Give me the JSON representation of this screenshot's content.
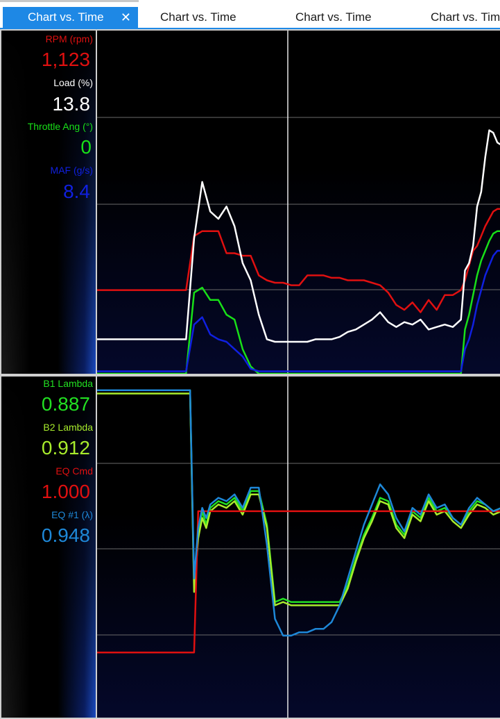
{
  "tabs": [
    {
      "label": "Chart vs. Time",
      "active": true,
      "close": "✕"
    },
    {
      "label": "Chart vs. Time",
      "active": false
    },
    {
      "label": "Chart vs. Time",
      "active": false
    },
    {
      "label": "Chart vs. Tim",
      "active": false
    }
  ],
  "top_panel": {
    "channels": [
      {
        "label": "RPM (rpm)",
        "value": "1,123",
        "color": "#e01010"
      },
      {
        "label": "Load (%)",
        "value": "13.8",
        "color": "#ffffff"
      },
      {
        "label": "Throttle Ang (°)",
        "value": "0",
        "color": "#18e018"
      },
      {
        "label": "MAF (g/s)",
        "value": "8.4",
        "color": "#1020e0"
      }
    ]
  },
  "bottom_panel": {
    "channels": [
      {
        "label": "B1 Lambda",
        "value": "0.887",
        "color": "#22e022"
      },
      {
        "label": "B2 Lambda",
        "value": "0.912",
        "color": "#a8ec2c"
      },
      {
        "label": "EQ Cmd",
        "value": "1.000",
        "color": "#e01010"
      },
      {
        "label": "EQ #1 (λ)",
        "value": "0.948",
        "color": "#1e88d8"
      }
    ]
  },
  "chart_data": [
    {
      "type": "line",
      "title": "",
      "xlabel": "",
      "ylabel": "",
      "grid": true,
      "x": [
        0,
        3,
        6,
        10,
        12,
        14,
        16,
        18,
        20,
        22,
        24,
        26,
        28,
        30,
        32,
        34,
        36,
        38,
        40,
        42,
        44,
        46,
        48,
        50,
        52,
        54,
        56,
        58,
        60,
        62,
        64,
        66,
        68,
        70,
        72,
        74,
        76,
        78,
        80,
        82,
        84,
        86,
        88,
        90,
        91,
        92,
        93,
        94,
        95,
        96,
        97,
        98,
        99,
        100
      ],
      "series": [
        {
          "name": "RPM (rpm)",
          "color": "#e01010",
          "values": [
            0.34,
            0.34,
            0.34,
            0.34,
            0.34,
            0.34,
            0.34,
            0.34,
            0.34,
            0.34,
            0.56,
            0.58,
            0.58,
            0.58,
            0.49,
            0.49,
            0.48,
            0.48,
            0.4,
            0.38,
            0.37,
            0.37,
            0.36,
            0.36,
            0.4,
            0.4,
            0.4,
            0.39,
            0.39,
            0.38,
            0.38,
            0.38,
            0.37,
            0.36,
            0.33,
            0.28,
            0.26,
            0.29,
            0.25,
            0.3,
            0.26,
            0.32,
            0.32,
            0.34,
            0.38,
            0.44,
            0.5,
            0.52,
            0.56,
            0.6,
            0.63,
            0.66,
            0.67,
            0.67
          ]
        },
        {
          "name": "Load (%)",
          "color": "#ffffff",
          "values": [
            0.14,
            0.14,
            0.14,
            0.14,
            0.14,
            0.14,
            0.14,
            0.14,
            0.14,
            0.14,
            0.55,
            0.78,
            0.66,
            0.63,
            0.68,
            0.6,
            0.45,
            0.38,
            0.24,
            0.14,
            0.13,
            0.13,
            0.13,
            0.13,
            0.13,
            0.14,
            0.14,
            0.14,
            0.15,
            0.17,
            0.18,
            0.2,
            0.22,
            0.25,
            0.21,
            0.19,
            0.21,
            0.2,
            0.22,
            0.18,
            0.19,
            0.2,
            0.19,
            0.22,
            0.42,
            0.45,
            0.52,
            0.68,
            0.74,
            0.88,
            0.99,
            0.98,
            0.94,
            0.93
          ]
        },
        {
          "name": "Throttle Ang (°)",
          "color": "#18e018",
          "values": [
            0.0,
            0.0,
            0.0,
            0.0,
            0.0,
            0.0,
            0.0,
            0.0,
            0.0,
            0.0,
            0.33,
            0.35,
            0.3,
            0.3,
            0.24,
            0.22,
            0.1,
            0.03,
            0.0,
            0.0,
            0.0,
            0.0,
            0.0,
            0.0,
            0.0,
            0.0,
            0.0,
            0.0,
            0.0,
            0.0,
            0.0,
            0.0,
            0.0,
            0.0,
            0.0,
            0.0,
            0.0,
            0.0,
            0.0,
            0.0,
            0.0,
            0.0,
            0.0,
            0.0,
            0.18,
            0.24,
            0.32,
            0.4,
            0.46,
            0.5,
            0.54,
            0.57,
            0.58,
            0.58
          ]
        },
        {
          "name": "MAF (g/s)",
          "color": "#1020e0",
          "values": [
            0.01,
            0.01,
            0.01,
            0.01,
            0.01,
            0.01,
            0.01,
            0.01,
            0.01,
            0.01,
            0.2,
            0.23,
            0.16,
            0.14,
            0.13,
            0.1,
            0.07,
            0.02,
            0.01,
            0.01,
            0.01,
            0.01,
            0.01,
            0.01,
            0.01,
            0.01,
            0.01,
            0.01,
            0.01,
            0.01,
            0.01,
            0.01,
            0.01,
            0.01,
            0.01,
            0.01,
            0.01,
            0.01,
            0.01,
            0.01,
            0.01,
            0.01,
            0.01,
            0.01,
            0.1,
            0.14,
            0.2,
            0.28,
            0.34,
            0.4,
            0.44,
            0.48,
            0.5,
            0.5
          ]
        }
      ]
    },
    {
      "type": "line",
      "title": "",
      "xlabel": "",
      "ylabel": "",
      "grid": true,
      "x": [
        0,
        3,
        6,
        10,
        12,
        14,
        16,
        18,
        20,
        22,
        23,
        24,
        25,
        26,
        27,
        28,
        30,
        32,
        34,
        36,
        38,
        40,
        42,
        44,
        46,
        48,
        50,
        52,
        54,
        56,
        58,
        60,
        62,
        64,
        66,
        68,
        70,
        72,
        74,
        76,
        78,
        80,
        82,
        84,
        86,
        88,
        90,
        92,
        94,
        96,
        98,
        100
      ],
      "series": [
        {
          "name": "B1 Lambda",
          "color": "#22e022",
          "values": [
            0.98,
            0.98,
            0.98,
            0.98,
            0.98,
            0.98,
            0.98,
            0.98,
            0.98,
            0.98,
            0.98,
            0.4,
            0.55,
            0.62,
            0.58,
            0.63,
            0.65,
            0.64,
            0.66,
            0.62,
            0.68,
            0.68,
            0.58,
            0.35,
            0.36,
            0.35,
            0.35,
            0.35,
            0.35,
            0.35,
            0.35,
            0.35,
            0.4,
            0.48,
            0.55,
            0.6,
            0.66,
            0.65,
            0.58,
            0.55,
            0.62,
            0.6,
            0.66,
            0.62,
            0.63,
            0.6,
            0.58,
            0.62,
            0.65,
            0.64,
            0.62,
            0.63
          ]
        },
        {
          "name": "B2 Lambda",
          "color": "#a8ec2c",
          "values": [
            0.97,
            0.97,
            0.97,
            0.97,
            0.97,
            0.97,
            0.97,
            0.97,
            0.97,
            0.97,
            0.97,
            0.38,
            0.54,
            0.6,
            0.57,
            0.62,
            0.64,
            0.63,
            0.65,
            0.61,
            0.67,
            0.67,
            0.57,
            0.34,
            0.35,
            0.34,
            0.34,
            0.34,
            0.34,
            0.34,
            0.34,
            0.34,
            0.39,
            0.47,
            0.54,
            0.59,
            0.65,
            0.64,
            0.57,
            0.54,
            0.61,
            0.59,
            0.65,
            0.61,
            0.62,
            0.59,
            0.57,
            0.61,
            0.64,
            0.63,
            0.61,
            0.62
          ]
        },
        {
          "name": "EQ Cmd",
          "color": "#e01010",
          "values": [
            0.2,
            0.2,
            0.2,
            0.2,
            0.2,
            0.2,
            0.2,
            0.2,
            0.2,
            0.2,
            0.2,
            0.2,
            0.62,
            0.62,
            0.62,
            0.62,
            0.62,
            0.62,
            0.62,
            0.62,
            0.62,
            0.62,
            0.62,
            0.62,
            0.62,
            0.62,
            0.62,
            0.62,
            0.62,
            0.62,
            0.62,
            0.62,
            0.62,
            0.62,
            0.62,
            0.62,
            0.62,
            0.62,
            0.62,
            0.62,
            0.62,
            0.62,
            0.62,
            0.62,
            0.62,
            0.62,
            0.62,
            0.62,
            0.62,
            0.62,
            0.62,
            0.62
          ]
        },
        {
          "name": "EQ #1 (λ)",
          "color": "#1e88d8",
          "values": [
            0.98,
            0.98,
            0.98,
            0.98,
            0.98,
            0.98,
            0.98,
            0.98,
            0.98,
            0.98,
            0.98,
            0.42,
            0.57,
            0.63,
            0.6,
            0.64,
            0.66,
            0.65,
            0.67,
            0.63,
            0.69,
            0.69,
            0.52,
            0.3,
            0.25,
            0.25,
            0.26,
            0.26,
            0.27,
            0.27,
            0.29,
            0.34,
            0.42,
            0.5,
            0.58,
            0.64,
            0.7,
            0.67,
            0.6,
            0.56,
            0.63,
            0.61,
            0.67,
            0.63,
            0.64,
            0.6,
            0.58,
            0.63,
            0.66,
            0.64,
            0.62,
            0.63
          ]
        }
      ]
    }
  ]
}
